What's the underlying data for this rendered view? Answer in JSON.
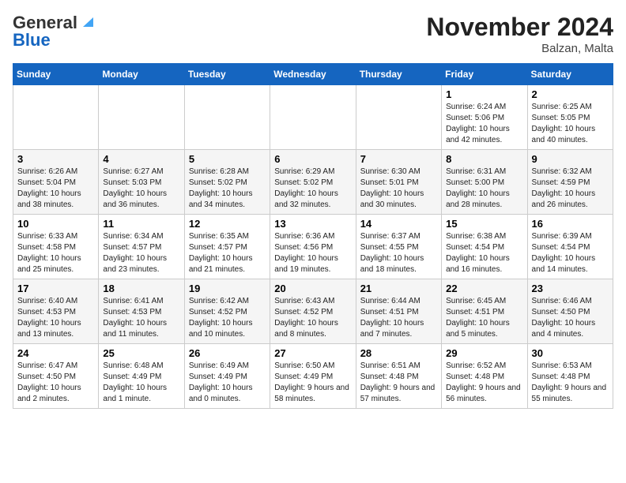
{
  "logo": {
    "line1": "General",
    "line2": "Blue"
  },
  "title": "November 2024",
  "location": "Balzan, Malta",
  "columns": [
    "Sunday",
    "Monday",
    "Tuesday",
    "Wednesday",
    "Thursday",
    "Friday",
    "Saturday"
  ],
  "weeks": [
    [
      {
        "day": "",
        "info": ""
      },
      {
        "day": "",
        "info": ""
      },
      {
        "day": "",
        "info": ""
      },
      {
        "day": "",
        "info": ""
      },
      {
        "day": "",
        "info": ""
      },
      {
        "day": "1",
        "info": "Sunrise: 6:24 AM\nSunset: 5:06 PM\nDaylight: 10 hours and 42 minutes."
      },
      {
        "day": "2",
        "info": "Sunrise: 6:25 AM\nSunset: 5:05 PM\nDaylight: 10 hours and 40 minutes."
      }
    ],
    [
      {
        "day": "3",
        "info": "Sunrise: 6:26 AM\nSunset: 5:04 PM\nDaylight: 10 hours and 38 minutes."
      },
      {
        "day": "4",
        "info": "Sunrise: 6:27 AM\nSunset: 5:03 PM\nDaylight: 10 hours and 36 minutes."
      },
      {
        "day": "5",
        "info": "Sunrise: 6:28 AM\nSunset: 5:02 PM\nDaylight: 10 hours and 34 minutes."
      },
      {
        "day": "6",
        "info": "Sunrise: 6:29 AM\nSunset: 5:02 PM\nDaylight: 10 hours and 32 minutes."
      },
      {
        "day": "7",
        "info": "Sunrise: 6:30 AM\nSunset: 5:01 PM\nDaylight: 10 hours and 30 minutes."
      },
      {
        "day": "8",
        "info": "Sunrise: 6:31 AM\nSunset: 5:00 PM\nDaylight: 10 hours and 28 minutes."
      },
      {
        "day": "9",
        "info": "Sunrise: 6:32 AM\nSunset: 4:59 PM\nDaylight: 10 hours and 26 minutes."
      }
    ],
    [
      {
        "day": "10",
        "info": "Sunrise: 6:33 AM\nSunset: 4:58 PM\nDaylight: 10 hours and 25 minutes."
      },
      {
        "day": "11",
        "info": "Sunrise: 6:34 AM\nSunset: 4:57 PM\nDaylight: 10 hours and 23 minutes."
      },
      {
        "day": "12",
        "info": "Sunrise: 6:35 AM\nSunset: 4:57 PM\nDaylight: 10 hours and 21 minutes."
      },
      {
        "day": "13",
        "info": "Sunrise: 6:36 AM\nSunset: 4:56 PM\nDaylight: 10 hours and 19 minutes."
      },
      {
        "day": "14",
        "info": "Sunrise: 6:37 AM\nSunset: 4:55 PM\nDaylight: 10 hours and 18 minutes."
      },
      {
        "day": "15",
        "info": "Sunrise: 6:38 AM\nSunset: 4:54 PM\nDaylight: 10 hours and 16 minutes."
      },
      {
        "day": "16",
        "info": "Sunrise: 6:39 AM\nSunset: 4:54 PM\nDaylight: 10 hours and 14 minutes."
      }
    ],
    [
      {
        "day": "17",
        "info": "Sunrise: 6:40 AM\nSunset: 4:53 PM\nDaylight: 10 hours and 13 minutes."
      },
      {
        "day": "18",
        "info": "Sunrise: 6:41 AM\nSunset: 4:53 PM\nDaylight: 10 hours and 11 minutes."
      },
      {
        "day": "19",
        "info": "Sunrise: 6:42 AM\nSunset: 4:52 PM\nDaylight: 10 hours and 10 minutes."
      },
      {
        "day": "20",
        "info": "Sunrise: 6:43 AM\nSunset: 4:52 PM\nDaylight: 10 hours and 8 minutes."
      },
      {
        "day": "21",
        "info": "Sunrise: 6:44 AM\nSunset: 4:51 PM\nDaylight: 10 hours and 7 minutes."
      },
      {
        "day": "22",
        "info": "Sunrise: 6:45 AM\nSunset: 4:51 PM\nDaylight: 10 hours and 5 minutes."
      },
      {
        "day": "23",
        "info": "Sunrise: 6:46 AM\nSunset: 4:50 PM\nDaylight: 10 hours and 4 minutes."
      }
    ],
    [
      {
        "day": "24",
        "info": "Sunrise: 6:47 AM\nSunset: 4:50 PM\nDaylight: 10 hours and 2 minutes."
      },
      {
        "day": "25",
        "info": "Sunrise: 6:48 AM\nSunset: 4:49 PM\nDaylight: 10 hours and 1 minute."
      },
      {
        "day": "26",
        "info": "Sunrise: 6:49 AM\nSunset: 4:49 PM\nDaylight: 10 hours and 0 minutes."
      },
      {
        "day": "27",
        "info": "Sunrise: 6:50 AM\nSunset: 4:49 PM\nDaylight: 9 hours and 58 minutes."
      },
      {
        "day": "28",
        "info": "Sunrise: 6:51 AM\nSunset: 4:48 PM\nDaylight: 9 hours and 57 minutes."
      },
      {
        "day": "29",
        "info": "Sunrise: 6:52 AM\nSunset: 4:48 PM\nDaylight: 9 hours and 56 minutes."
      },
      {
        "day": "30",
        "info": "Sunrise: 6:53 AM\nSunset: 4:48 PM\nDaylight: 9 hours and 55 minutes."
      }
    ]
  ]
}
